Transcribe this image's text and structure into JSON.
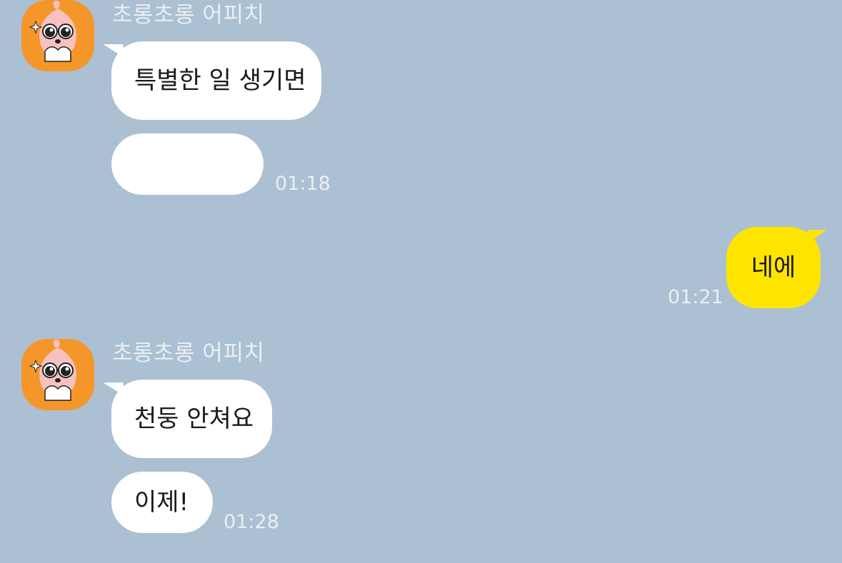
{
  "chat": {
    "sender_name": "초롱초롱 어피치",
    "avatar_icon": "apeach-avatar-icon",
    "colors": {
      "background": "#abc0d2",
      "incoming_bubble": "#ffffff",
      "outgoing_bubble": "#fee500",
      "avatar_bg": "#f5962a"
    },
    "group1": {
      "sender_name": "초롱초롱 어피치",
      "messages": [
        {
          "text": "특별한 일 생기면"
        },
        {
          "text": ""
        }
      ],
      "time": "01:18"
    },
    "mine": {
      "text": "네에",
      "time": "01:21"
    },
    "group2": {
      "sender_name": "초롱초롱 어피치",
      "messages": [
        {
          "text": "천둥 안쳐요"
        },
        {
          "text": "이제!"
        }
      ],
      "time": "01:28"
    }
  }
}
